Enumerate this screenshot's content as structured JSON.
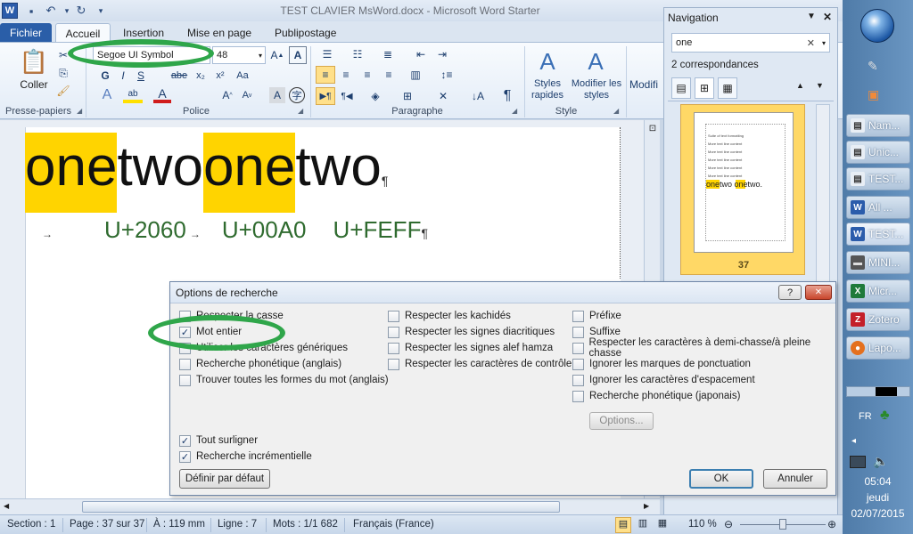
{
  "window": {
    "title": "TEST CLAVIER MsWord.docx - Microsoft Word Starter"
  },
  "tabs": [
    "Fichier",
    "Accueil",
    "Insertion",
    "Mise en page",
    "Publipostage"
  ],
  "ribbon": {
    "clipboard": {
      "paste_label": "Coller",
      "group_label": "Presse-papiers"
    },
    "font": {
      "font_name": "Segoe UI Symbol",
      "font_size": "48",
      "group_label": "Police",
      "bold": "G",
      "italic": "I",
      "underline": "S",
      "strike": "abe"
    },
    "paragraph": {
      "group_label": "Paragraphe"
    },
    "style": {
      "quick_styles_label": "Styles rapides",
      "change_styles_label": "Modifier les styles",
      "group_label": "Style",
      "edit_label": "Modifi"
    }
  },
  "document": {
    "line1": [
      {
        "text": "one",
        "highlight": true
      },
      {
        "text": "two",
        "highlight": false
      },
      {
        "text": " ",
        "highlight": false
      },
      {
        "text": "one",
        "highlight": true
      },
      {
        "text": "two",
        "highlight": false
      }
    ],
    "pilcrow": "¶",
    "tab_arrow": "→",
    "codes": [
      "U+2060",
      "U+00A0",
      "U+FEFF"
    ]
  },
  "navigation": {
    "title": "Navigation",
    "search_value": "one",
    "matches": "2 correspondances",
    "thumb_page_number": "37",
    "thumb_lines": [
      "Suite of text formatting",
      "More text line content",
      "More text line content",
      "More text line content",
      "More text line content",
      "More text line content"
    ],
    "thumb_highlight": "onetwo onetwo."
  },
  "dialog": {
    "title": "Options de recherche",
    "help": "?",
    "close": "✕",
    "col1": [
      {
        "label": "Respecter la casse",
        "checked": false
      },
      {
        "label": "Mot entier",
        "checked": true
      },
      {
        "label": "Utiliser les caractères génériques",
        "checked": false
      },
      {
        "label": "Recherche phonétique (anglais)",
        "checked": false
      },
      {
        "label": "Trouver toutes les formes du mot (anglais)",
        "checked": false
      }
    ],
    "col2": [
      {
        "label": "Respecter les kachidés",
        "checked": false
      },
      {
        "label": "Respecter les signes diacritiques",
        "checked": false
      },
      {
        "label": "Respecter les signes alef hamza",
        "checked": false
      },
      {
        "label": "Respecter les caractères de contrôle",
        "checked": false
      }
    ],
    "col3": [
      {
        "label": "Préfixe",
        "checked": false
      },
      {
        "label": "Suffixe",
        "checked": false
      },
      {
        "label": "Respecter les caractères à demi-chasse/à pleine chasse",
        "checked": false
      },
      {
        "label": "Ignorer les marques de ponctuation",
        "checked": false
      },
      {
        "label": "Ignorer les caractères d'espacement",
        "checked": false
      },
      {
        "label": "Recherche phonétique (japonais)",
        "checked": false
      }
    ],
    "options_button": "Options...",
    "bottom": [
      {
        "label": "Tout surligner",
        "checked": true
      },
      {
        "label": "Recherche incrémentielle",
        "checked": true
      }
    ],
    "default_button": "Définir par défaut",
    "ok_button": "OK",
    "cancel_button": "Annuler"
  },
  "statusbar": {
    "section": "Section : 1",
    "page": "Page : 37 sur 37",
    "position": "À : 119 mm",
    "line": "Ligne : 7",
    "words": "Mots : 1/1 682",
    "language": "Français (France)",
    "zoom": "110 %"
  },
  "taskbar": {
    "items": [
      {
        "label": "Nam...",
        "icon": "doc"
      },
      {
        "label": "Unic...",
        "icon": "doc"
      },
      {
        "label": "TEST...",
        "icon": "doc"
      },
      {
        "label": "All ...",
        "icon": "word"
      },
      {
        "label": "TEST...",
        "icon": "word"
      },
      {
        "label": "MINI...",
        "icon": "drive"
      },
      {
        "label": "Micr...",
        "icon": "excel"
      },
      {
        "label": "Zotero",
        "icon": "zotero"
      },
      {
        "label": "Lapo...",
        "icon": "firefox"
      }
    ],
    "lang": "FR",
    "time": "05:04",
    "day": "jeudi",
    "date": "02/07/2015"
  },
  "colors": {
    "highlight": "#ffd400",
    "annotation": "#2fa64a",
    "accent": "#2a5ea8"
  }
}
